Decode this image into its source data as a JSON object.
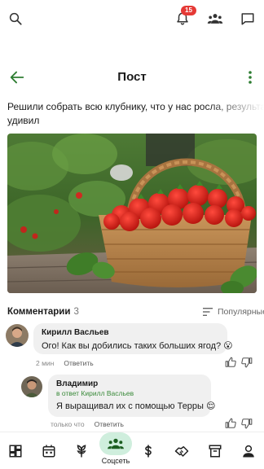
{
  "topbar": {
    "notifications_count": "15"
  },
  "header": {
    "title": "Пост"
  },
  "post": {
    "text_line1": "Решили собрать всю клубнику, что у нас росла, результат",
    "text_line2": "удивил"
  },
  "comments": {
    "title": "Комментарии",
    "count": "3",
    "sort_label": "Популярные",
    "items": [
      {
        "author": "Кирилл Васльев",
        "text": "Ого! Как вы добились таких больших ягод? 😮",
        "time": "2 мин",
        "reply_label": "Ответить"
      },
      {
        "author": "Владимир",
        "reply_to": "в ответ Кирилл Васльев",
        "text": "Я выращивал их с помощью Терры 😌",
        "time": "только что",
        "reply_label": "Ответить"
      }
    ]
  },
  "bottom_nav": {
    "active_label": "Соцсеть"
  },
  "colors": {
    "accent_green": "#2e7d32",
    "active_pill": "#cfeedd",
    "badge_red": "#e53935"
  }
}
